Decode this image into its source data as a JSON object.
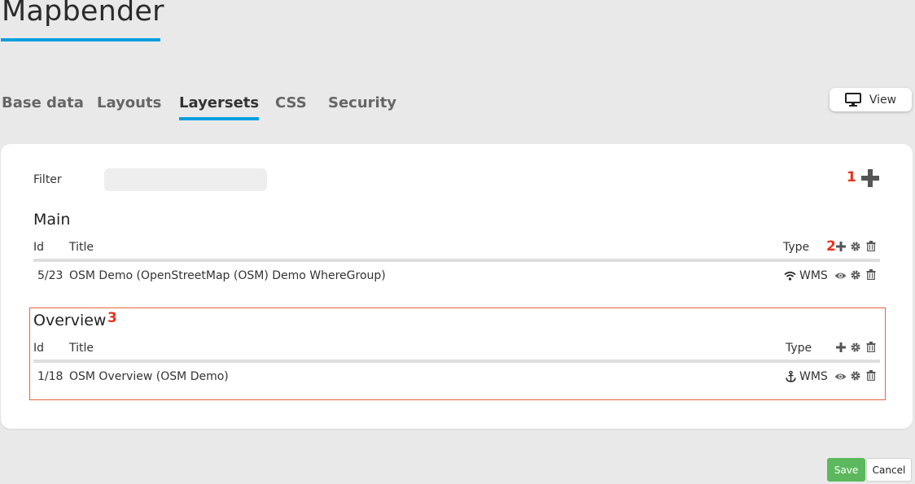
{
  "header": {
    "app_title": "Mapbender"
  },
  "tabs": [
    {
      "label": "Base data"
    },
    {
      "label": "Layouts"
    },
    {
      "label": "Layersets",
      "active": true
    },
    {
      "label": "CSS"
    },
    {
      "label": "Security"
    }
  ],
  "view_button": {
    "label": "View",
    "icon": "monitor-icon"
  },
  "filter": {
    "label": "Filter",
    "value": "",
    "placeholder": ""
  },
  "annotations": {
    "a1": "1",
    "a2": "2",
    "a3": "3"
  },
  "layersets": [
    {
      "title": "Main",
      "columns": {
        "id": "Id",
        "title": "Title",
        "type": "Type"
      },
      "rows": [
        {
          "id": "5/23",
          "title": "OSM Demo (OpenStreetMap (OSM) Demo WhereGroup)",
          "type": "WMS",
          "type_icon": "wifi-icon"
        }
      ]
    },
    {
      "title": "Overview",
      "columns": {
        "id": "Id",
        "title": "Title",
        "type": "Type"
      },
      "rows": [
        {
          "id": "1/18",
          "title": "OSM Overview (OSM Demo)",
          "type": "WMS",
          "type_icon": "anchor-icon"
        }
      ]
    }
  ],
  "footer": {
    "save_label": "Save",
    "cancel_label": "Cancel"
  },
  "colors": {
    "accent": "#079ee0",
    "save": "#5cb85c",
    "annotation": "#e8321a"
  }
}
